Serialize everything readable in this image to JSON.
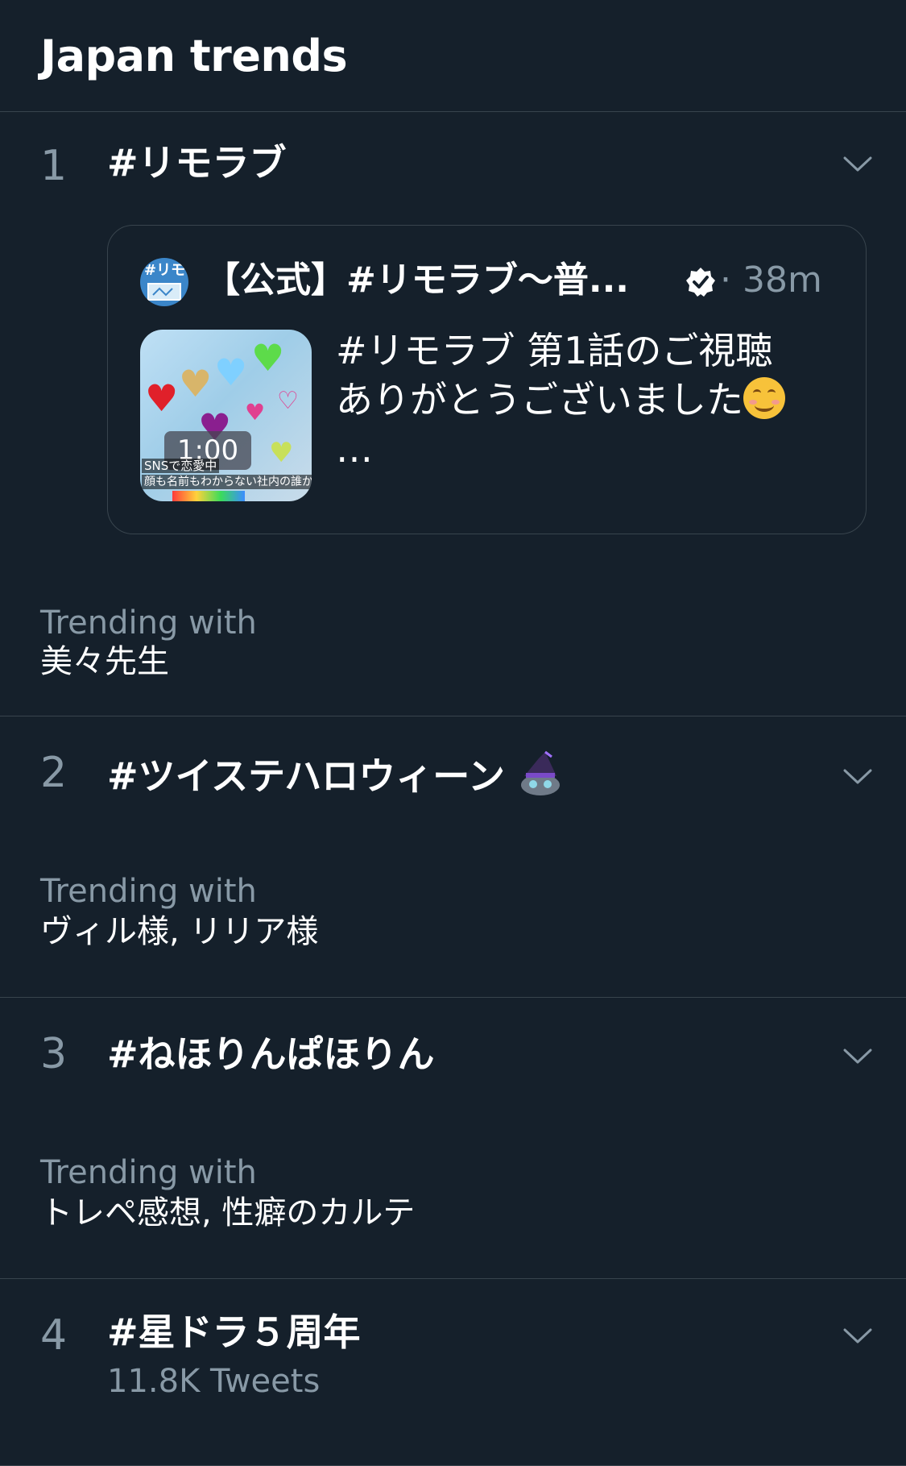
{
  "header": {
    "title": "Japan trends"
  },
  "trends": [
    {
      "rank": "1",
      "name": "#リモラブ",
      "tweet": {
        "author": "【公式】#リモラブ〜普...",
        "avatar_text": "#リモ",
        "time": "· 38m",
        "media_duration": "1:00",
        "media_caption1": "SNSで恋愛中",
        "media_caption2": "顔も名前もわからない社内の誰か",
        "text_line1": "#リモラブ 第1話のご視聴",
        "text_line2": "ありがとうございました",
        "text_line3": "…"
      },
      "trending_with_label": "Trending with",
      "trending_with": "美々先生"
    },
    {
      "rank": "2",
      "name": "#ツイステハロウィーン",
      "trending_with_label": "Trending with",
      "trending_with": "ヴィル様, リリア様"
    },
    {
      "rank": "3",
      "name": "#ねほりんぱほりん",
      "trending_with_label": "Trending with",
      "trending_with": "トレペ感想, 性癖のカルテ"
    },
    {
      "rank": "4",
      "name": "#星ドラ５周年",
      "tweets": "11.8K Tweets"
    }
  ],
  "icons": {
    "chevron": "chevron-down-icon",
    "verified": "verified-badge-icon",
    "emoji_smile": "smiling-face-icon",
    "emoji_witch": "witch-hat-cat-icon"
  },
  "colors": {
    "background": "#15202b",
    "secondary_text": "#8899a6",
    "divider": "#38444d"
  }
}
